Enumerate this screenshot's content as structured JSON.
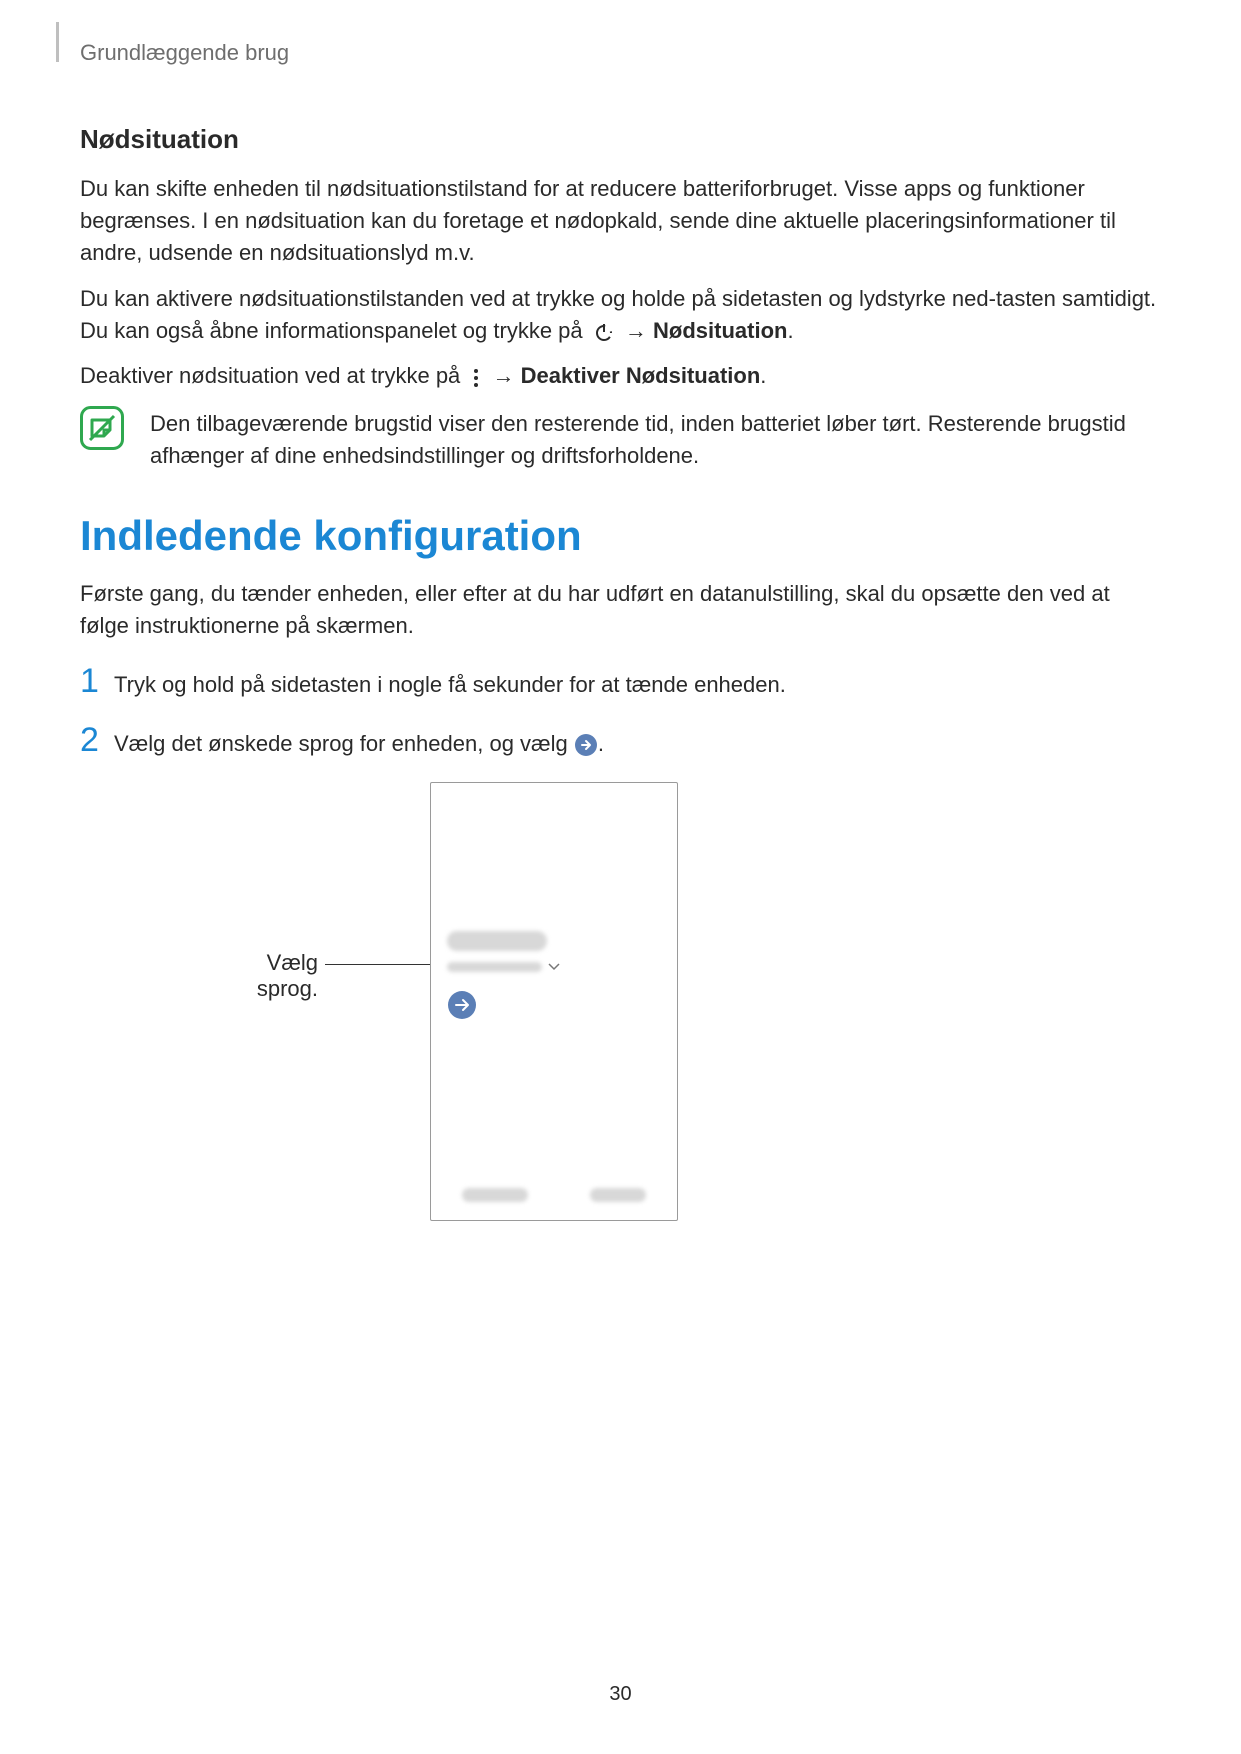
{
  "header": {
    "breadcrumb": "Grundlæggende brug"
  },
  "section1": {
    "title": "Nødsituation",
    "p1": "Du kan skifte enheden til nødsituationstilstand for at reducere batteriforbruget. Visse apps og funktioner begrænses. I en nødsituation kan du foretage et nødopkald, sende dine aktuelle placeringsinformationer til andre, udsende en nødsituationslyd m.v.",
    "p2a": "Du kan aktivere nødsituationstilstanden ved at trykke og holde på sidetasten og lydstyrke ned-tasten samtidigt. Du kan også åbne informationspanelet og trykke på ",
    "p2_arrow": " → ",
    "p2_bold": "Nødsituation",
    "p2_end": ".",
    "p3a": "Deaktiver nødsituation ved at trykke på ",
    "p3_arrow": " → ",
    "p3_bold": "Deaktiver Nødsituation",
    "p3_end": ".",
    "note": "Den tilbageværende brugstid viser den resterende tid, inden batteriet løber tørt. Resterende brugstid afhænger af dine enhedsindstillinger og driftsforholdene."
  },
  "section2": {
    "title": "Indledende konfiguration",
    "intro": "Første gang, du tænder enheden, eller efter at du har udført en datanulstilling, skal du opsætte den ved at følge instruktionerne på skærmen.",
    "steps": [
      {
        "num": "1",
        "text": "Tryk og hold på sidetasten i nogle få sekunder for at tænde enheden."
      },
      {
        "num": "2",
        "text_a": "Vælg det ønskede sprog for enheden, og vælg ",
        "text_b": "."
      }
    ],
    "callout": "Vælg sprog."
  },
  "icons": {
    "power": "power-icon",
    "more": "more-vert-icon",
    "note": "note-icon",
    "arrow_circle": "arrow-right-circle-icon",
    "chevron": "chevron-down-icon"
  },
  "page_number": "30"
}
